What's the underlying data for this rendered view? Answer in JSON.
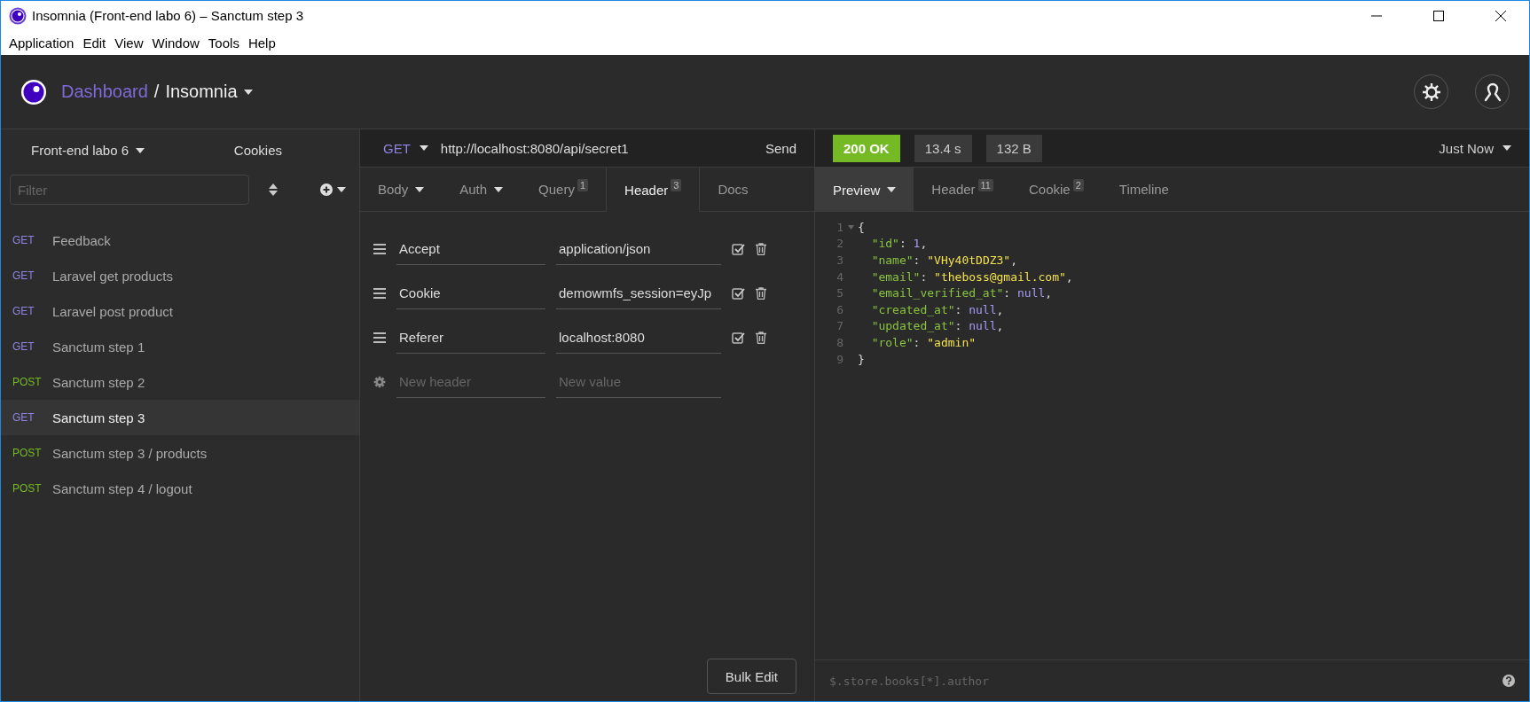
{
  "window": {
    "title": "Insomnia (Front-end labo 6) – Sanctum step 3"
  },
  "menu": [
    "Application",
    "Edit",
    "View",
    "Window",
    "Tools",
    "Help"
  ],
  "header": {
    "dashboard": "Dashboard",
    "separator": "/",
    "project": "Insomnia"
  },
  "sidebar": {
    "workspace": "Front-end labo 6",
    "cookies": "Cookies",
    "filter": {
      "placeholder": "Filter"
    },
    "requests": [
      {
        "method": "GET",
        "name": "Feedback",
        "selected": false
      },
      {
        "method": "GET",
        "name": "Laravel get products",
        "selected": false
      },
      {
        "method": "GET",
        "name": "Laravel post product",
        "selected": false
      },
      {
        "method": "GET",
        "name": "Sanctum step 1",
        "selected": false
      },
      {
        "method": "POST",
        "name": "Sanctum step 2",
        "selected": false
      },
      {
        "method": "GET",
        "name": "Sanctum step 3",
        "selected": true
      },
      {
        "method": "POST",
        "name": "Sanctum step 3 / products",
        "selected": false
      },
      {
        "method": "POST",
        "name": "Sanctum step 4 / logout",
        "selected": false
      }
    ]
  },
  "request": {
    "method": "GET",
    "url": "http://localhost:8080/api/secret1",
    "send": "Send",
    "tabs": [
      {
        "label": "Body",
        "kind": "dropdown",
        "selected": false
      },
      {
        "label": "Auth",
        "kind": "dropdown",
        "selected": false
      },
      {
        "label": "Query",
        "kind": "counted",
        "count": "1",
        "selected": false
      },
      {
        "label": "Header",
        "kind": "counted",
        "count": "3",
        "selected": true
      },
      {
        "label": "Docs",
        "kind": "plain",
        "selected": false
      }
    ],
    "headers": [
      {
        "name": "Accept",
        "value": "application/json",
        "checked": true
      },
      {
        "name": "Cookie",
        "value": "demowmfs_session=eyJp",
        "checked": true
      },
      {
        "name": "Referer",
        "value": "localhost:8080",
        "checked": true
      }
    ],
    "new_header": {
      "name_placeholder": "New header",
      "value_placeholder": "New value"
    },
    "bulk_edit": "Bulk Edit"
  },
  "response": {
    "status": "200 OK",
    "time": "13.4 s",
    "size": "132 B",
    "history": "Just Now",
    "tabs": [
      {
        "label": "Preview",
        "kind": "dropdown",
        "selected": true
      },
      {
        "label": "Header",
        "kind": "counted",
        "count": "11",
        "selected": false
      },
      {
        "label": "Cookie",
        "kind": "counted",
        "count": "2",
        "selected": false
      },
      {
        "label": "Timeline",
        "kind": "plain",
        "selected": false
      }
    ],
    "code": [
      {
        "number": "1",
        "foldable": true,
        "tokens": [
          {
            "kind": "punct",
            "text": "{"
          }
        ]
      },
      {
        "number": "2",
        "foldable": false,
        "tokens": [
          {
            "kind": "key",
            "text": "\"id\""
          },
          {
            "kind": "punct",
            "text": ": "
          },
          {
            "kind": "number",
            "text": "1"
          },
          {
            "kind": "punct",
            "text": ","
          }
        ]
      },
      {
        "number": "3",
        "foldable": false,
        "tokens": [
          {
            "kind": "key",
            "text": "\"name\""
          },
          {
            "kind": "punct",
            "text": ": "
          },
          {
            "kind": "string",
            "text": "\"VHy40tDDZ3\""
          },
          {
            "kind": "punct",
            "text": ","
          }
        ]
      },
      {
        "number": "4",
        "foldable": false,
        "tokens": [
          {
            "kind": "key",
            "text": "\"email\""
          },
          {
            "kind": "punct",
            "text": ": "
          },
          {
            "kind": "string",
            "text": "\"theboss@gmail.com\""
          },
          {
            "kind": "punct",
            "text": ","
          }
        ]
      },
      {
        "number": "5",
        "foldable": false,
        "tokens": [
          {
            "kind": "key",
            "text": "\"email_verified_at\""
          },
          {
            "kind": "punct",
            "text": ": "
          },
          {
            "kind": "null",
            "text": "null"
          },
          {
            "kind": "punct",
            "text": ","
          }
        ]
      },
      {
        "number": "6",
        "foldable": false,
        "tokens": [
          {
            "kind": "key",
            "text": "\"created_at\""
          },
          {
            "kind": "punct",
            "text": ": "
          },
          {
            "kind": "null",
            "text": "null"
          },
          {
            "kind": "punct",
            "text": ","
          }
        ]
      },
      {
        "number": "7",
        "foldable": false,
        "tokens": [
          {
            "kind": "key",
            "text": "\"updated_at\""
          },
          {
            "kind": "punct",
            "text": ": "
          },
          {
            "kind": "null",
            "text": "null"
          },
          {
            "kind": "punct",
            "text": ","
          }
        ]
      },
      {
        "number": "8",
        "foldable": false,
        "tokens": [
          {
            "kind": "key",
            "text": "\"role\""
          },
          {
            "kind": "punct",
            "text": ": "
          },
          {
            "kind": "string",
            "text": "\"admin\""
          }
        ]
      },
      {
        "number": "9",
        "foldable": false,
        "tokens": [
          {
            "kind": "punct",
            "text": "}"
          }
        ]
      }
    ],
    "filter": {
      "placeholder": "$.store.books[*].author"
    }
  }
}
